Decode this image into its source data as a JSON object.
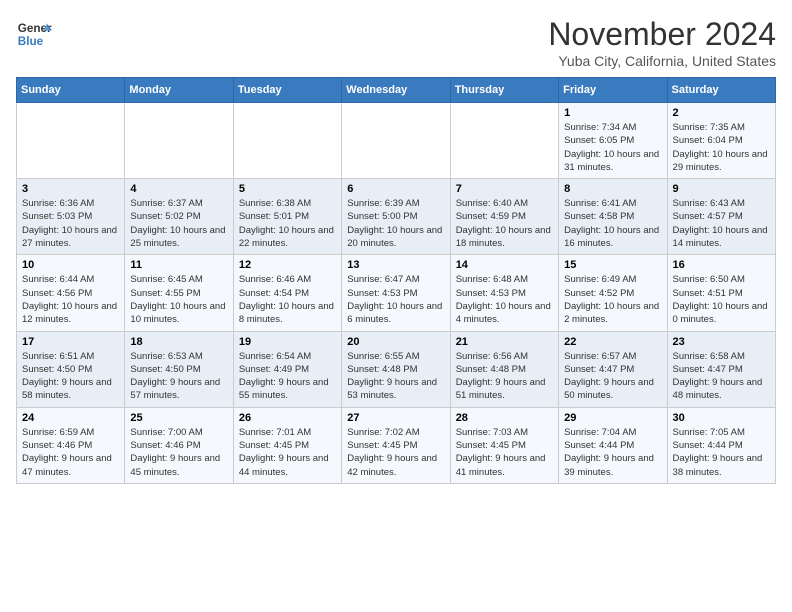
{
  "logo": {
    "line1": "General",
    "line2": "Blue"
  },
  "title": "November 2024",
  "subtitle": "Yuba City, California, United States",
  "days_of_week": [
    "Sunday",
    "Monday",
    "Tuesday",
    "Wednesday",
    "Thursday",
    "Friday",
    "Saturday"
  ],
  "weeks": [
    [
      {
        "day": "",
        "info": ""
      },
      {
        "day": "",
        "info": ""
      },
      {
        "day": "",
        "info": ""
      },
      {
        "day": "",
        "info": ""
      },
      {
        "day": "",
        "info": ""
      },
      {
        "day": "1",
        "info": "Sunrise: 7:34 AM\nSunset: 6:05 PM\nDaylight: 10 hours and 31 minutes."
      },
      {
        "day": "2",
        "info": "Sunrise: 7:35 AM\nSunset: 6:04 PM\nDaylight: 10 hours and 29 minutes."
      }
    ],
    [
      {
        "day": "3",
        "info": "Sunrise: 6:36 AM\nSunset: 5:03 PM\nDaylight: 10 hours and 27 minutes."
      },
      {
        "day": "4",
        "info": "Sunrise: 6:37 AM\nSunset: 5:02 PM\nDaylight: 10 hours and 25 minutes."
      },
      {
        "day": "5",
        "info": "Sunrise: 6:38 AM\nSunset: 5:01 PM\nDaylight: 10 hours and 22 minutes."
      },
      {
        "day": "6",
        "info": "Sunrise: 6:39 AM\nSunset: 5:00 PM\nDaylight: 10 hours and 20 minutes."
      },
      {
        "day": "7",
        "info": "Sunrise: 6:40 AM\nSunset: 4:59 PM\nDaylight: 10 hours and 18 minutes."
      },
      {
        "day": "8",
        "info": "Sunrise: 6:41 AM\nSunset: 4:58 PM\nDaylight: 10 hours and 16 minutes."
      },
      {
        "day": "9",
        "info": "Sunrise: 6:43 AM\nSunset: 4:57 PM\nDaylight: 10 hours and 14 minutes."
      }
    ],
    [
      {
        "day": "10",
        "info": "Sunrise: 6:44 AM\nSunset: 4:56 PM\nDaylight: 10 hours and 12 minutes."
      },
      {
        "day": "11",
        "info": "Sunrise: 6:45 AM\nSunset: 4:55 PM\nDaylight: 10 hours and 10 minutes."
      },
      {
        "day": "12",
        "info": "Sunrise: 6:46 AM\nSunset: 4:54 PM\nDaylight: 10 hours and 8 minutes."
      },
      {
        "day": "13",
        "info": "Sunrise: 6:47 AM\nSunset: 4:53 PM\nDaylight: 10 hours and 6 minutes."
      },
      {
        "day": "14",
        "info": "Sunrise: 6:48 AM\nSunset: 4:53 PM\nDaylight: 10 hours and 4 minutes."
      },
      {
        "day": "15",
        "info": "Sunrise: 6:49 AM\nSunset: 4:52 PM\nDaylight: 10 hours and 2 minutes."
      },
      {
        "day": "16",
        "info": "Sunrise: 6:50 AM\nSunset: 4:51 PM\nDaylight: 10 hours and 0 minutes."
      }
    ],
    [
      {
        "day": "17",
        "info": "Sunrise: 6:51 AM\nSunset: 4:50 PM\nDaylight: 9 hours and 58 minutes."
      },
      {
        "day": "18",
        "info": "Sunrise: 6:53 AM\nSunset: 4:50 PM\nDaylight: 9 hours and 57 minutes."
      },
      {
        "day": "19",
        "info": "Sunrise: 6:54 AM\nSunset: 4:49 PM\nDaylight: 9 hours and 55 minutes."
      },
      {
        "day": "20",
        "info": "Sunrise: 6:55 AM\nSunset: 4:48 PM\nDaylight: 9 hours and 53 minutes."
      },
      {
        "day": "21",
        "info": "Sunrise: 6:56 AM\nSunset: 4:48 PM\nDaylight: 9 hours and 51 minutes."
      },
      {
        "day": "22",
        "info": "Sunrise: 6:57 AM\nSunset: 4:47 PM\nDaylight: 9 hours and 50 minutes."
      },
      {
        "day": "23",
        "info": "Sunrise: 6:58 AM\nSunset: 4:47 PM\nDaylight: 9 hours and 48 minutes."
      }
    ],
    [
      {
        "day": "24",
        "info": "Sunrise: 6:59 AM\nSunset: 4:46 PM\nDaylight: 9 hours and 47 minutes."
      },
      {
        "day": "25",
        "info": "Sunrise: 7:00 AM\nSunset: 4:46 PM\nDaylight: 9 hours and 45 minutes."
      },
      {
        "day": "26",
        "info": "Sunrise: 7:01 AM\nSunset: 4:45 PM\nDaylight: 9 hours and 44 minutes."
      },
      {
        "day": "27",
        "info": "Sunrise: 7:02 AM\nSunset: 4:45 PM\nDaylight: 9 hours and 42 minutes."
      },
      {
        "day": "28",
        "info": "Sunrise: 7:03 AM\nSunset: 4:45 PM\nDaylight: 9 hours and 41 minutes."
      },
      {
        "day": "29",
        "info": "Sunrise: 7:04 AM\nSunset: 4:44 PM\nDaylight: 9 hours and 39 minutes."
      },
      {
        "day": "30",
        "info": "Sunrise: 7:05 AM\nSunset: 4:44 PM\nDaylight: 9 hours and 38 minutes."
      }
    ]
  ]
}
